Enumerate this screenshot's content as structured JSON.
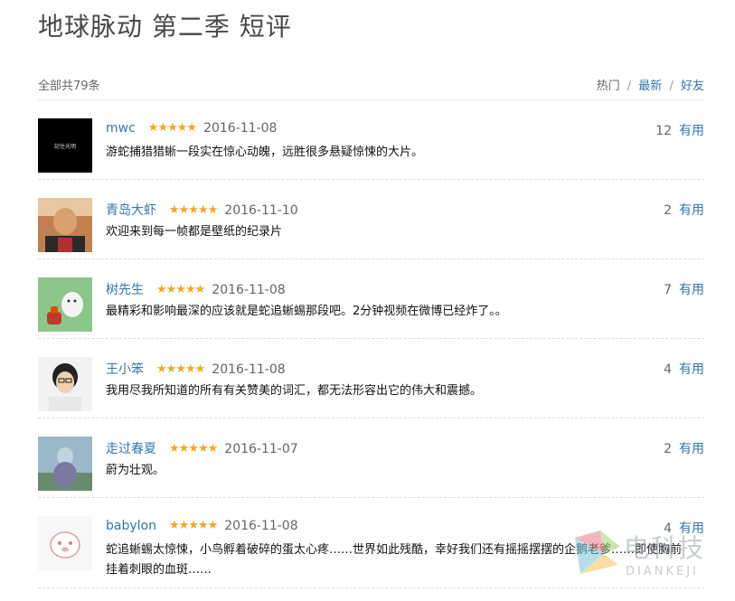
{
  "page": {
    "title": "地球脉动 第二季 短评"
  },
  "summary": {
    "total_text": "全部共79条",
    "tabs": {
      "hot": "热门",
      "latest": "最新",
      "friends": "好友",
      "sep": "/"
    }
  },
  "reviews": [
    {
      "user": "mwc",
      "stars": "★★★★★",
      "date": "2016-11-08",
      "votes": "12",
      "useful": "有用",
      "text": "游蛇捕猎猎蜥一段实在惊心动魄，远胜很多悬疑惊悚的大片。"
    },
    {
      "user": "青岛大虾",
      "stars": "★★★★★",
      "date": "2016-11-10",
      "votes": "2",
      "useful": "有用",
      "text": "欢迎来到每一帧都是壁纸的纪录片"
    },
    {
      "user": "树先生",
      "stars": "★★★★★",
      "date": "2016-11-08",
      "votes": "7",
      "useful": "有用",
      "text": "最精彩和影响最深的应该就是蛇追蜥蜴那段吧。2分钟视频在微博已经炸了。。"
    },
    {
      "user": "王小笨",
      "stars": "★★★★★",
      "date": "2016-11-08",
      "votes": "4",
      "useful": "有用",
      "text": "我用尽我所知道的所有有关赞美的词汇，都无法形容出它的伟大和震撼。"
    },
    {
      "user": "走过春夏",
      "stars": "★★★★★",
      "date": "2016-11-07",
      "votes": "2",
      "useful": "有用",
      "text": "蔚为壮观。"
    },
    {
      "user": "babylon",
      "stars": "★★★★★",
      "date": "2016-11-08",
      "votes": "4",
      "useful": "有用",
      "text": "蛇追蜥蜴太惊悚，小鸟孵着破碎的蛋太心疼……世界如此残酷，幸好我们还有摇摇摆摆的企鹅老爹……即使胸前挂着刺眼的血斑……"
    }
  ],
  "avatars": [
    {
      "name": "avatar-mwc",
      "caption": "記住光明"
    }
  ],
  "watermark": {
    "cn": "电科技",
    "en": "DIANKEJI"
  }
}
